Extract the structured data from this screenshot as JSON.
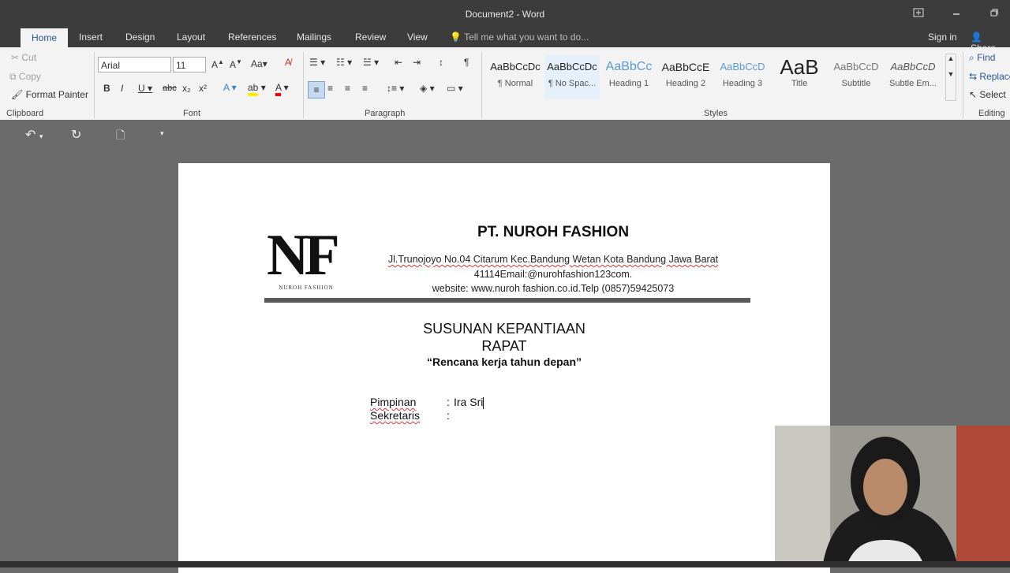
{
  "window": {
    "title": "Document2 - Word"
  },
  "tabs": {
    "items": [
      "Home",
      "Insert",
      "Design",
      "Layout",
      "References",
      "Mailings",
      "Review",
      "View"
    ],
    "tell_me": "Tell me what you want to do...",
    "sign_in": "Sign in",
    "share": "Share"
  },
  "clipboard": {
    "cut": "Cut",
    "copy": "Copy",
    "format_painter": "Format Painter",
    "label": "Clipboard"
  },
  "font": {
    "family": "Arial",
    "size": "11",
    "aa": "Aa",
    "label": "Font"
  },
  "paragraph": {
    "label": "Paragraph"
  },
  "styles": {
    "label": "Styles",
    "tiles": [
      {
        "preview": "AaBbCcDc",
        "name": "¶ Normal"
      },
      {
        "preview": "AaBbCcDc",
        "name": "¶ No Spac..."
      },
      {
        "preview": "AaBbCc",
        "name": "Heading 1"
      },
      {
        "preview": "AaBbCcE",
        "name": "Heading 2"
      },
      {
        "preview": "AaBbCcD",
        "name": "Heading 3"
      },
      {
        "preview": "AaB",
        "name": "Title"
      },
      {
        "preview": "AaBbCcD",
        "name": "Subtitle"
      },
      {
        "preview": "AaBbCcD",
        "name": "Subtle Em..."
      }
    ]
  },
  "editing": {
    "find": "Find",
    "replace": "Replace",
    "select": "Select",
    "label": "Editing"
  },
  "document": {
    "logo_text": "NF",
    "logo_subtext": "NUROH FASHION",
    "company": "PT. NUROH FASHION",
    "address1": "Jl.Trunojoyo No.04 Citarum Kec.Bandung Wetan Kota Bandung Jawa Barat",
    "address2": "41114Email:@nurohfashion123com.",
    "address3": "website: www.nuroh fashion.co.id.Telp (0857)59425073",
    "heading1": "SUSUNAN KEPANTIAAN",
    "heading2": "RAPAT",
    "subheading": "“Rencana kerja tahun depan”",
    "rows": [
      {
        "label": "Pimpinan",
        "colon": ":",
        "value": "Ira Sri"
      },
      {
        "label": "Sekretaris",
        "colon": ":",
        "value": ""
      }
    ]
  },
  "colors": {
    "accent": "#2b579a",
    "titlebar": "#3c3c3c",
    "ribbon": "#f3f3f3",
    "canvas": "#6b6b6b"
  }
}
